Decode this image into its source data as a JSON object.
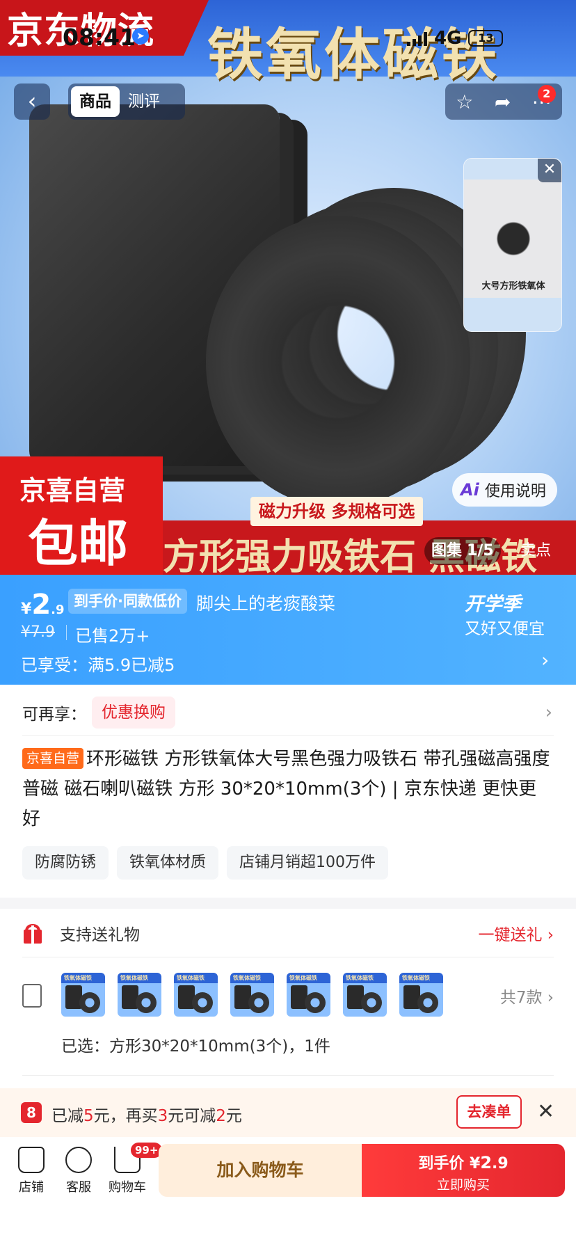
{
  "status": {
    "time": "08:41",
    "network": "4G",
    "battery": "13"
  },
  "hero": {
    "logo_text": "京东物流",
    "title": "铁氧体磁铁",
    "badge_line1": "京喜自营",
    "badge_line2": "包邮",
    "slogan": "磁力升级 多规格可选",
    "strip_text": "方形强力吸铁石 黑磁铁",
    "ai_label": "Ai",
    "ai_text": "使用说明",
    "gallery_label": "图集",
    "gallery_count": "1/5",
    "sell_points": "卖点",
    "video_caption": "大号方形铁氧体"
  },
  "nav": {
    "back_icon": "chevron-left-icon",
    "tabs": [
      {
        "label": "商品"
      },
      {
        "label": "测评"
      }
    ],
    "more_badge": "2"
  },
  "price": {
    "currency": "¥",
    "integer": "2",
    "decimal": ".9",
    "tag": "到手价·同款低价",
    "user": "脚尖上的老痰酸菜",
    "original": "¥7.9",
    "sold": "已售2万+",
    "promo": "已享受：满5.9已减5",
    "season": "开学季",
    "season_sub": "又好又便宜"
  },
  "more": {
    "label": "可再享：",
    "chip": "优惠换购"
  },
  "product": {
    "tag": "京喜自营",
    "title": "环形磁铁 方形铁氧体大号黑色强力吸铁石 带孔强磁高强度普磁 磁石喇叭磁铁 方形 30*20*10mm(3个) | 京东快递 更快更好"
  },
  "tags": [
    "防腐防锈",
    "铁氧体材质",
    "店铺月销超100万件"
  ],
  "gift": {
    "label": "支持送礼物",
    "action": "一键送礼 ›"
  },
  "sku": {
    "thumb_label": "铁氧体磁铁",
    "count": "共7款 ›",
    "selected": "已选：方形30*20*10mm(3个)，1件"
  },
  "promo": {
    "logo": "8",
    "text_a": "已减",
    "num_a": "5",
    "text_b": "元，再买",
    "num_b": "3",
    "text_c": "元可减",
    "num_c": "2",
    "text_d": "元",
    "button": "去凑单"
  },
  "bottom": {
    "store": "店铺",
    "service": "客服",
    "cart": "购物车",
    "cart_badge": "99+",
    "add_cart": "加入购物车",
    "buy_price_label": "到手价",
    "buy_currency": "¥",
    "buy_int": "2",
    "buy_dec": ".9",
    "buy_now": "立即购买"
  }
}
